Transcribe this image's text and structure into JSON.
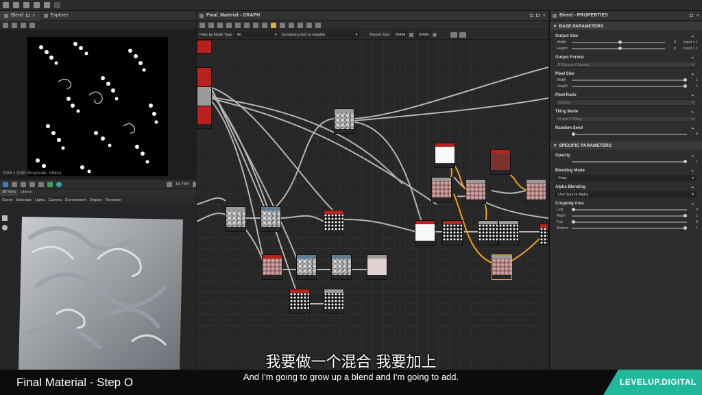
{
  "left_top": {
    "tabs": [
      {
        "label": "Blend"
      },
      {
        "label": "Explorer"
      }
    ],
    "status": "2048 x 2048 (Grayscale, 16bpc)"
  },
  "view3d": {
    "zoom": "18.79%",
    "tabs": [
      {
        "label": "3D View"
      },
      {
        "label": "Library"
      }
    ],
    "menu": [
      "Scene",
      "Materials",
      "Lights",
      "Camera",
      "Environment",
      "Display",
      "Renderer"
    ]
  },
  "graph": {
    "title": "Final_Material - GRAPH",
    "filter_label": "Filter by Node Type",
    "filter_value": "All",
    "containing_label": "Containing text or variable",
    "parent_size_label": "Parent Size:",
    "parent_size_a": "2048",
    "parent_size_b": "2048"
  },
  "props": {
    "title": "Blend - PROPERTIES",
    "base_section": "BASE PARAMETERS",
    "specific_section": "SPECIFIC PARAMETERS",
    "output_size": {
      "label": "Output Size",
      "width_label": "Width",
      "height_label": "Height",
      "width_val": "0",
      "height_val": "0",
      "width_extra": "Input x 1",
      "height_extra": "Input x 1"
    },
    "output_format": {
      "label": "Output Format",
      "value": "8 Bits per Channel"
    },
    "pixel_size": {
      "label": "Pixel Size",
      "width_label": "Width",
      "height_label": "Height",
      "width_val": "1",
      "height_val": "1"
    },
    "pixel_ratio": {
      "label": "Pixel Ratio",
      "value": "Square"
    },
    "tiling_mode": {
      "label": "Tiling Mode",
      "value": "H and V Tiling"
    },
    "random_seed": {
      "label": "Random Seed",
      "value": "0"
    },
    "opacity": {
      "label": "Opacity",
      "value": "1"
    },
    "blending_mode": {
      "label": "Blending Mode",
      "value": "Copy"
    },
    "alpha_blending": {
      "label": "Alpha Blending",
      "value": "Use Source Alpha"
    },
    "cropping": {
      "label": "Cropping Area",
      "rows": [
        {
          "label": "Left",
          "value": "0"
        },
        {
          "label": "Right",
          "value": "1"
        },
        {
          "label": "Top",
          "value": "0"
        },
        {
          "label": "Bottom",
          "value": "1"
        }
      ]
    }
  },
  "footer": {
    "step": "Final Material - Step O",
    "subtitle_cn": "我要做一个混合 我要加上",
    "subtitle_en": "And I'm going to grow up a blend and I'm going to add.",
    "brand": "LEVELUP.DIGITAL"
  },
  "colors": {
    "accent_orange": "#f0a31c",
    "brand_green": "#1fb89b",
    "node_red": "#b8211d"
  }
}
